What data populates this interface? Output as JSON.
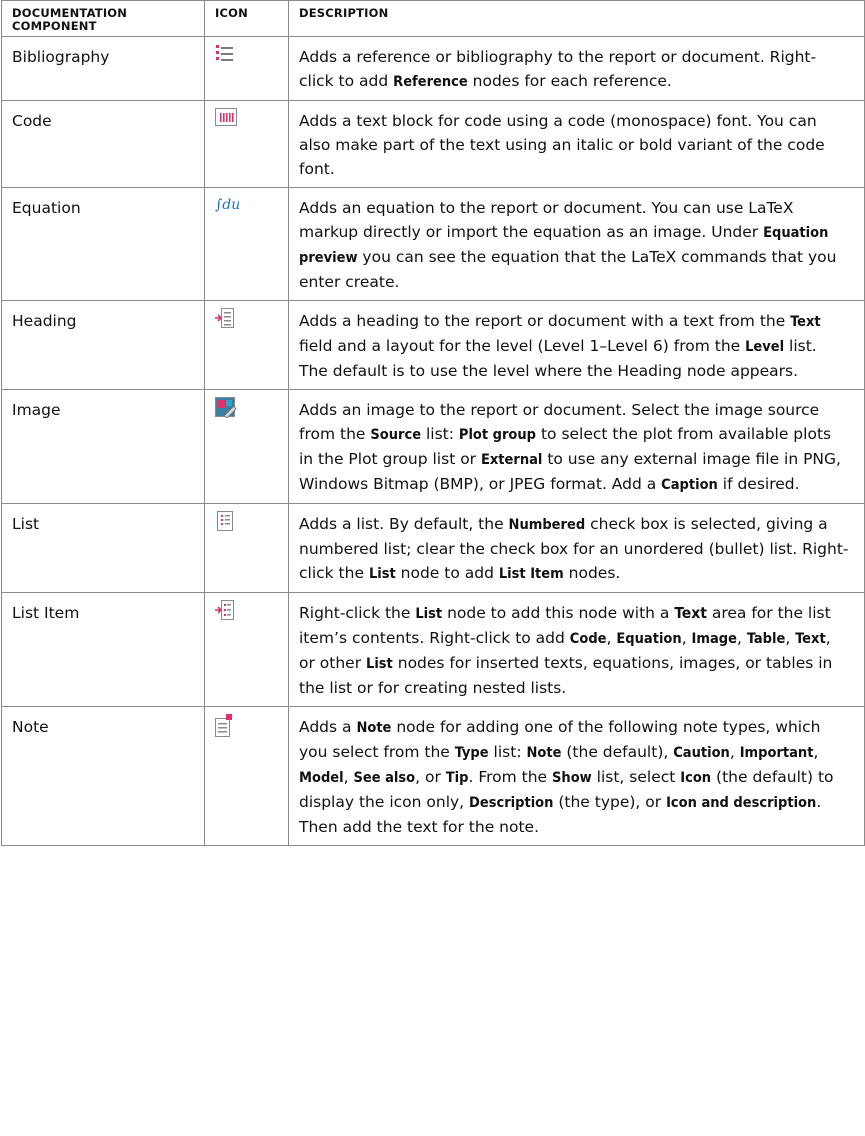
{
  "headers": [
    "DOCUMENTATION\nCOMPONENT",
    "ICON",
    "DESCRIPTION"
  ],
  "header_lines": {
    "c1a": "DOCUMENTATION",
    "c1b": "COMPONENT",
    "c2": "ICON",
    "c3": "DESCRIPTION"
  },
  "rows": [
    {
      "component": "Bibliography",
      "icon": "bibliography-icon",
      "description": [
        "Adds a reference or bibliography to the report or document. Right-click to add ",
        {
          "b": "Reference"
        },
        " nodes for each reference."
      ]
    },
    {
      "component": "Code",
      "icon": "code-icon",
      "description": [
        "Adds a text block for code using a code (monospace) font. You can also make part of the text using an italic or bold variant of the code font."
      ]
    },
    {
      "component": "Equation",
      "icon": "equation-icon",
      "description": [
        "Adds an equation to the report or document. You can use LaTeX markup directly or import the equation as an image. Under ",
        {
          "b": "Equation preview"
        },
        " you can see the equation that the LaTeX commands that you enter create."
      ]
    },
    {
      "component": "Heading",
      "icon": "heading-icon",
      "description": [
        "Adds a heading to the report or document with a text from the ",
        {
          "b": "Text"
        },
        " field and a layout for the level (Level 1–Level 6) from the ",
        {
          "b": "Level"
        },
        " list. The default is to use the level where the Heading node appears."
      ]
    },
    {
      "component": "Image",
      "icon": "image-icon",
      "description": [
        "Adds an image to the report or document. Select the image source from the ",
        {
          "b": "Source"
        },
        " list: ",
        {
          "b": "Plot group"
        },
        " to select the plot from available plots in the Plot group list or ",
        {
          "b": "External"
        },
        " to use any external image file in PNG, Windows Bitmap (BMP), or JPEG format. Add a ",
        {
          "b": "Caption"
        },
        " if desired."
      ]
    },
    {
      "component": "List",
      "icon": "list-icon",
      "description": [
        "Adds a list. By default, the ",
        {
          "b": "Numbered"
        },
        " check box is selected, giving a numbered list; clear the check box for an unordered (bullet) list. Right-click the ",
        {
          "b": "List"
        },
        " node to add ",
        {
          "b": "List Item"
        },
        " nodes."
      ]
    },
    {
      "component": "List Item",
      "icon": "list-item-icon",
      "description": [
        "Right-click the ",
        {
          "b": "List"
        },
        " node to add this node with a ",
        {
          "bw": "Text"
        },
        " area for the list item’s contents. Right-click to add ",
        {
          "b": "Code"
        },
        ", ",
        {
          "b": "Equation"
        },
        ", ",
        {
          "b": "Image"
        },
        ", ",
        {
          "b": "Table"
        },
        ", ",
        {
          "b": "Text"
        },
        ", or other ",
        {
          "b": "List"
        },
        " nodes for inserted texts, equations, images, or tables in the list or for creating nested lists."
      ]
    },
    {
      "component": "Note",
      "icon": "note-icon",
      "description": [
        "Adds a ",
        {
          "b": "Note"
        },
        " node for adding one of the following note types, which you select from the ",
        {
          "b": "Type"
        },
        " list: ",
        {
          "b": "Note"
        },
        " (the default), ",
        {
          "b": "Caution"
        },
        ", ",
        {
          "b": "Important"
        },
        ", ",
        {
          "b": "Model"
        },
        ", ",
        {
          "b": "See also"
        },
        ", or ",
        {
          "b": "Tip"
        },
        ". From the ",
        {
          "b": "Show"
        },
        " list, select ",
        {
          "b": "Icon"
        },
        " (the default) to display the icon only, ",
        {
          "b": "Description"
        },
        " (the type), or ",
        {
          "b": "Icon and description"
        },
        ". Then add the text for the note."
      ]
    }
  ]
}
